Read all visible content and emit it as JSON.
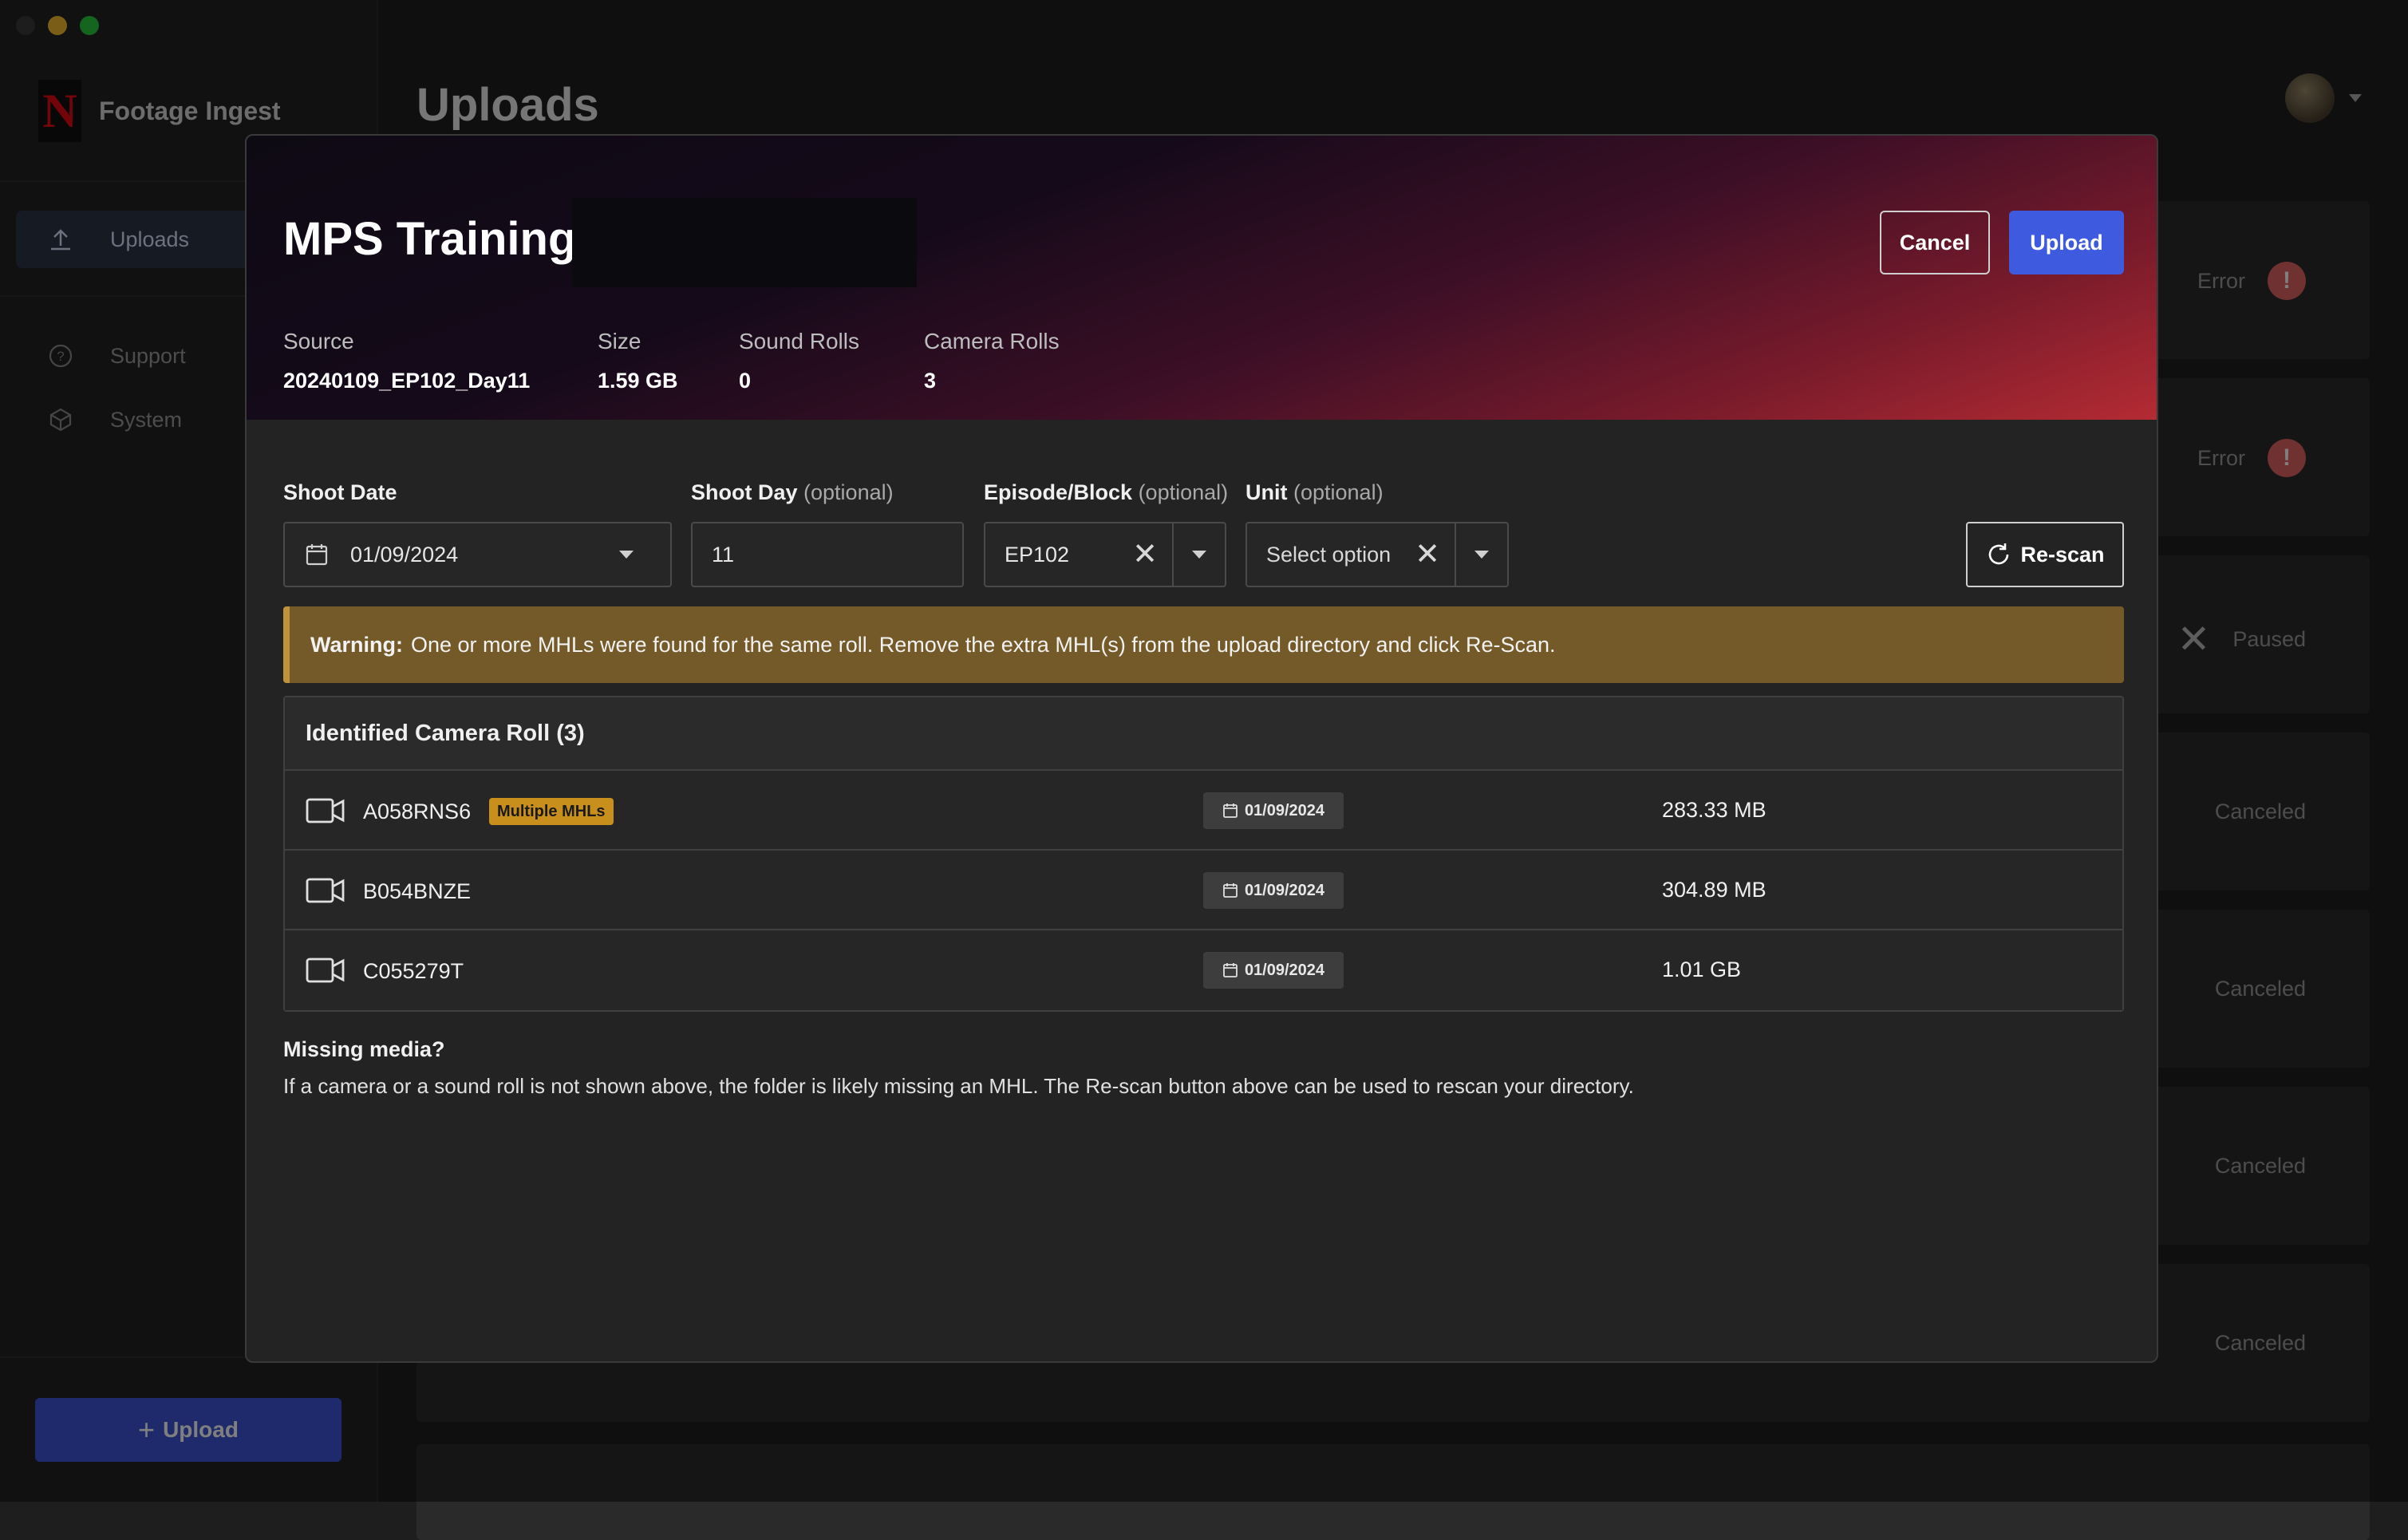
{
  "sidebar": {
    "brand": "Footage Ingest",
    "nav": [
      {
        "label": "Uploads",
        "icon": "upload-icon"
      },
      {
        "label": "Support",
        "icon": "help-circle-icon"
      },
      {
        "label": "System",
        "icon": "cube-icon"
      }
    ],
    "upload_button": "Upload"
  },
  "main": {
    "title": "Uploads",
    "background_statuses": [
      "Error",
      "Error",
      "Paused",
      "Canceled",
      "Canceled",
      "Canceled",
      "Canceled"
    ]
  },
  "modal": {
    "title": "MPS Training",
    "cancel_label": "Cancel",
    "upload_label": "Upload",
    "meta": [
      {
        "label": "Source",
        "value": "20240109_EP102_Day11"
      },
      {
        "label": "Size",
        "value": "1.59 GB"
      },
      {
        "label": "Sound Rolls",
        "value": "0"
      },
      {
        "label": "Camera Rolls",
        "value": "3"
      }
    ],
    "fields": {
      "shoot_date": {
        "label": "Shoot Date",
        "value": "01/09/2024"
      },
      "shoot_day": {
        "label": "Shoot Day",
        "optional": "(optional)",
        "value": "11"
      },
      "episode": {
        "label": "Episode/Block",
        "optional": "(optional)",
        "value": "EP102"
      },
      "unit": {
        "label": "Unit",
        "optional": "(optional)",
        "value": "Select option"
      }
    },
    "rescan_label": "Re-scan",
    "warning": {
      "prefix": "Warning:",
      "text": "One or more MHLs were found for the same roll. Remove the extra MHL(s) from the upload directory and click Re-Scan."
    },
    "table": {
      "header": "Identified Camera Roll (3)",
      "rows": [
        {
          "name": "A058RNS6",
          "badge": "Multiple MHLs",
          "date": "01/09/2024",
          "size": "283.33 MB"
        },
        {
          "name": "B054BNZE",
          "badge": "",
          "date": "01/09/2024",
          "size": "304.89 MB"
        },
        {
          "name": "C055279T",
          "badge": "",
          "date": "01/09/2024",
          "size": "1.01 GB"
        }
      ]
    },
    "missing": {
      "title": "Missing media?",
      "text": "If a camera or a sound roll is not shown above, the folder is likely missing an MHL. The Re-scan button above can be used to rescan your directory."
    }
  },
  "colors": {
    "accent": "#3e5be0",
    "warning_bg": "#735a28",
    "badge": "#c88f1d",
    "error": "#e06262"
  }
}
